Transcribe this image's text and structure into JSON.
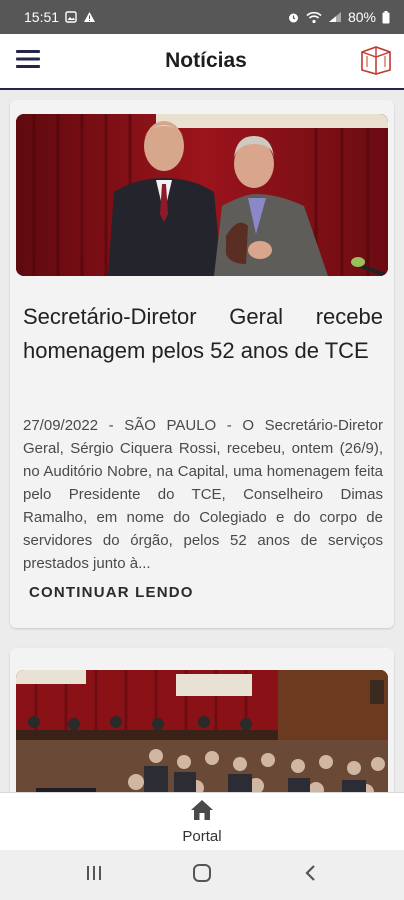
{
  "status_bar": {
    "time": "15:51",
    "battery": "80%"
  },
  "app_bar": {
    "title": "Notícias"
  },
  "articles": [
    {
      "headline": "Secretário-Diretor Geral recebe homenagem pelos 52 anos de TCE",
      "excerpt": "27/09/2022 - SÃO PAULO - O Secretário-Diretor Geral, Sérgio Ciquera Rossi, recebeu, ontem (26/9), no Auditório Nobre, na Capital, uma homenagem feita pelo Presidente do TCE, Conselheiro Dimas Ramalho, em nome do Colegiado e do corpo de servidores do órgão, pelos 52 anos de serviços prestados junto à...",
      "cta": "CONTINUAR LENDO"
    }
  ],
  "bottom_nav": {
    "portal_label": "Portal"
  },
  "colors": {
    "accent": "#c0392b",
    "curtain": "#8a1018",
    "appbar_border": "#23264a"
  }
}
